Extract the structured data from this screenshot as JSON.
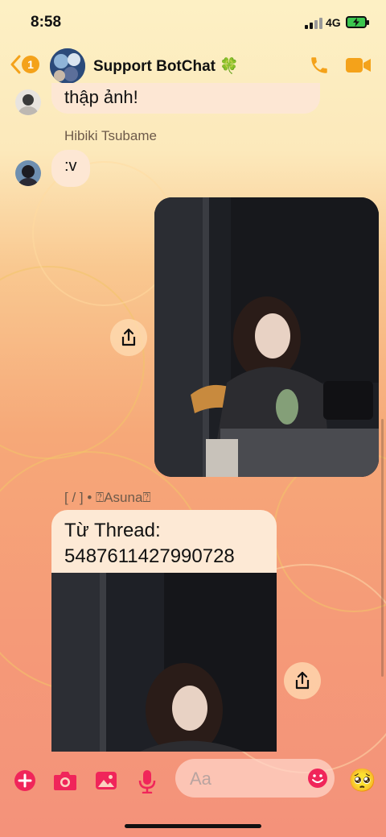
{
  "status_bar": {
    "time": "8:58",
    "network": "4G"
  },
  "header": {
    "unread_count": "1",
    "title": "Support BotChat 🍀"
  },
  "messages": {
    "m1_text": "thập ảnh!",
    "sender_2": "Hibiki Tsubame",
    "m2_text": ":v",
    "sender_3": "[ / ] • ⍰Asuna⍰",
    "thread_line1": "Từ Thread:",
    "thread_line2": "5487611427990728"
  },
  "composer": {
    "placeholder": "Aa",
    "quick_emoji": "🥺"
  },
  "colors": {
    "accent": "#f4a21a",
    "composer_icons": "#f0255a"
  }
}
